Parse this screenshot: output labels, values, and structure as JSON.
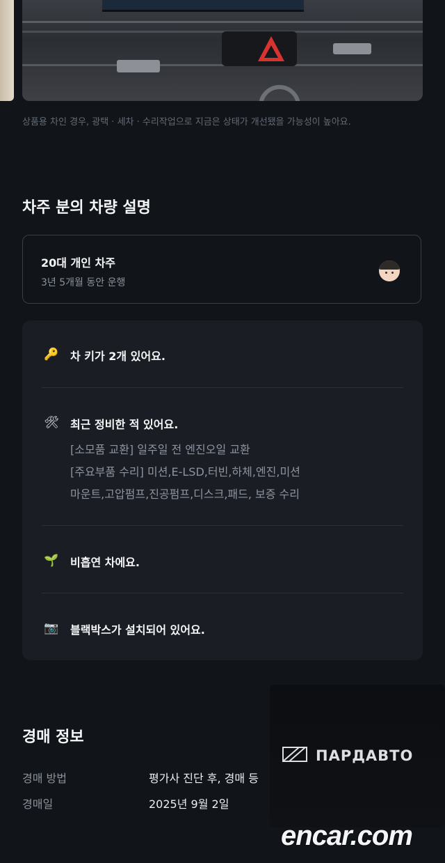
{
  "photo": {
    "caption": "상품용 차인 경우, 광택 · 세차 · 수리작업으로 지금은 상태가 개선됐을 가능성이 높아요."
  },
  "owner_section": {
    "title": "차주 분의 차량 설명",
    "owner_card": {
      "title": "20대 개인 차주",
      "subtitle": "3년 5개월 동안 운행",
      "avatar_icon": "boy-face-emoji"
    }
  },
  "features": [
    {
      "icon": "key-emoji",
      "glyph": "🔑",
      "title": "차 키가 2개 있어요."
    },
    {
      "icon": "hammer-wrench-emoji",
      "glyph": "🛠",
      "title": "최근 정비한 적 있어요.",
      "details": [
        "[소모품 교환] 일주일 전 엔진오일 교환",
        "[주요부품 수리] 미션,E-LSD,터빈,하체,엔진,미션",
        "마운트,고압펌프,진공펌프,디스크,패드, 보증 수리"
      ]
    },
    {
      "icon": "seedling-emoji",
      "glyph": "🌱",
      "title": "비흡연 차에요."
    },
    {
      "icon": "camera-emoji",
      "glyph": "📷",
      "title": "블랙박스가 설치되어 있어요."
    }
  ],
  "auction_section": {
    "title": "경매 정보",
    "rows": [
      {
        "label": "경매 방법",
        "value": "평가사 진단 후, 경매 등"
      },
      {
        "label": "경매일",
        "value": "2025년 9월 2일"
      }
    ]
  },
  "watermarks": {
    "logo_text": "ПАРДАВТО",
    "site_text": "encar.com"
  },
  "colors": {
    "background": "#111419",
    "card": "#1a1d23",
    "hazard_red": "#d8342f"
  }
}
